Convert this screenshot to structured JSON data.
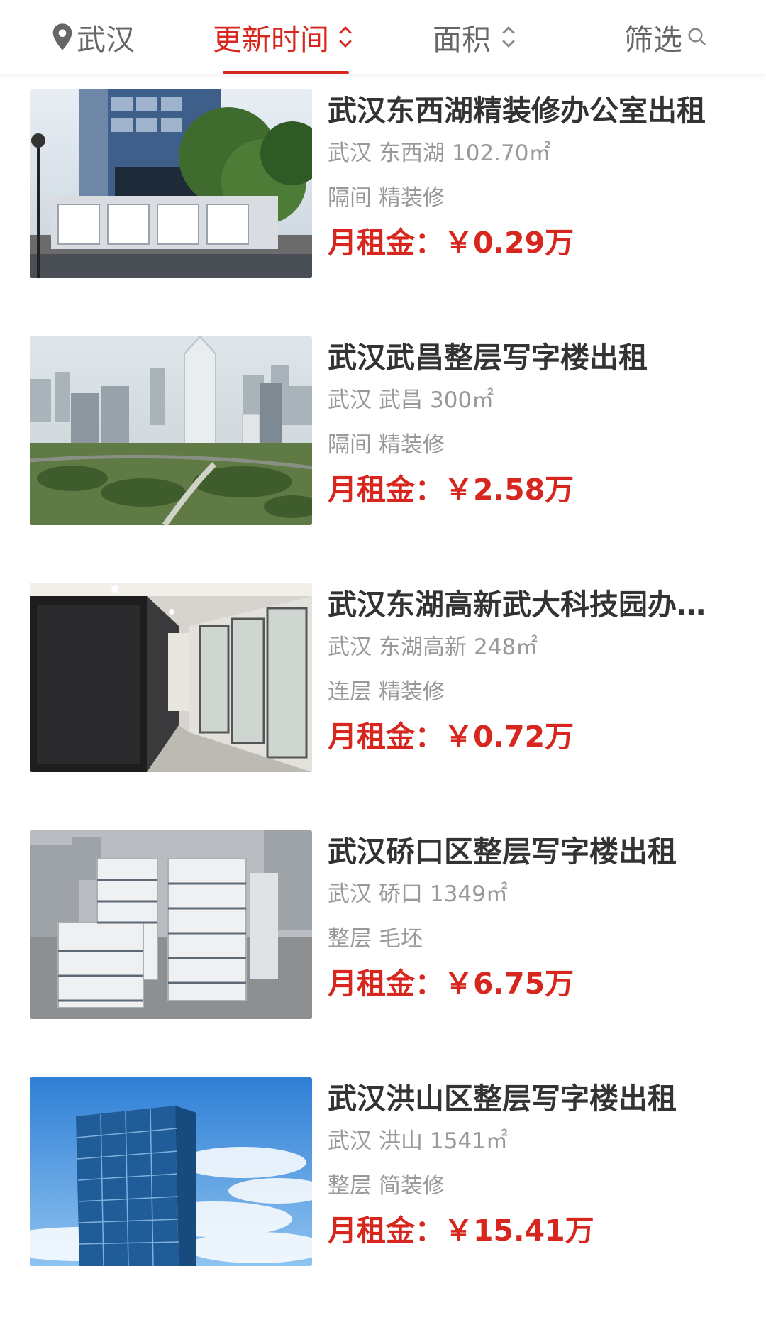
{
  "top_bar": {
    "location": "武汉",
    "sort_update_time": "更新时间",
    "sort_area": "面积",
    "filter": "筛选",
    "colors": {
      "accent": "#d7261e",
      "muted": "#666666"
    }
  },
  "listings": [
    {
      "title": "武汉东西湖精装修办公室出租",
      "city": "武汉",
      "district": "东西湖",
      "area": "102.70㎡",
      "layout": "隔间",
      "decoration": "精装修",
      "price_label": "月租金：",
      "price": "￥0.29万",
      "image": "office-park-sign-photo"
    },
    {
      "title": "武汉武昌整层写字楼出租",
      "city": "武汉",
      "district": "武昌",
      "area": "300㎡",
      "layout": "隔间",
      "decoration": "精装修",
      "price_label": "月租金：",
      "price": "￥2.58万",
      "image": "skyline-aerial-photo"
    },
    {
      "title": "武汉东湖高新武大科技园办公室",
      "city": "武汉",
      "district": "东湖高新",
      "area": "248㎡",
      "layout": "连层",
      "decoration": "精装修",
      "price_label": "月租金：",
      "price": "￥0.72万",
      "image": "office-corridor-photo"
    },
    {
      "title": "武汉硚口区整层写字楼出租",
      "city": "武汉",
      "district": "硚口",
      "area": "1349㎡",
      "layout": "整层",
      "decoration": "毛坯",
      "price_label": "月租金：",
      "price": "￥6.75万",
      "image": "office-towers-aerial-photo"
    },
    {
      "title": "武汉洪山区整层写字楼出租",
      "city": "武汉",
      "district": "洪山",
      "area": "1541㎡",
      "layout": "整层",
      "decoration": "简装修",
      "price_label": "月租金：",
      "price": "￥15.41万",
      "image": "glass-tower-sky-photo"
    }
  ]
}
